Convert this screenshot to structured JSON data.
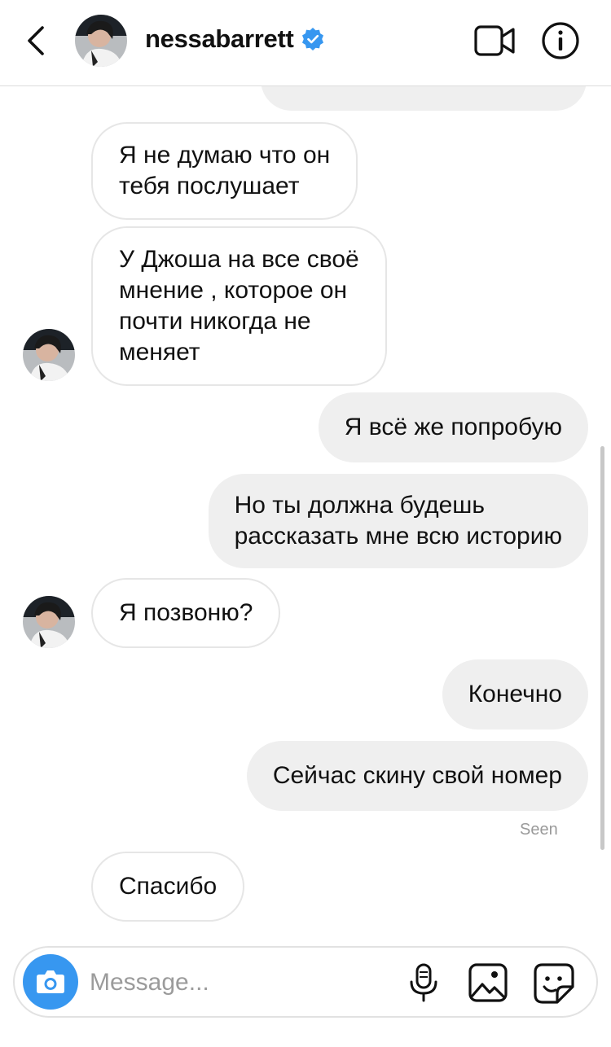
{
  "header": {
    "username": "nessabarrett",
    "verified": true,
    "back_icon": "chevron-left-icon",
    "video_icon": "video-camera-icon",
    "info_icon": "info-icon"
  },
  "messages": [
    {
      "direction": "out",
      "text": "",
      "partial": true
    },
    {
      "direction": "in",
      "lines": [
        "Я не думаю что он",
        "тебя послушает"
      ]
    },
    {
      "direction": "in",
      "lines": [
        "У Джоша на все своё",
        "мнение , которое он",
        "почти никогда не",
        "меняет"
      ],
      "avatar": true
    },
    {
      "direction": "out",
      "lines": [
        "Я всё же попробую"
      ]
    },
    {
      "direction": "out",
      "lines": [
        "Но ты должна будешь",
        "рассказать мне всю историю"
      ]
    },
    {
      "direction": "in",
      "lines": [
        "Я позвоню?"
      ],
      "avatar": true
    },
    {
      "direction": "out",
      "lines": [
        "Конечно"
      ]
    },
    {
      "direction": "out",
      "lines": [
        "Сейчас скину свой номер"
      ]
    },
    {
      "direction": "in",
      "lines": [
        "Спасибо"
      ]
    }
  ],
  "seen_label": "Seen",
  "composer": {
    "placeholder": "Message...",
    "camera_icon": "camera-icon",
    "mic_icon": "microphone-icon",
    "gallery_icon": "image-gallery-icon",
    "sticker_icon": "sticker-icon"
  },
  "colors": {
    "accent": "#3797f0",
    "outgoing_bubble": "#efefef",
    "incoming_border": "#e6e6e6",
    "verified_badge": "#3797f0"
  }
}
